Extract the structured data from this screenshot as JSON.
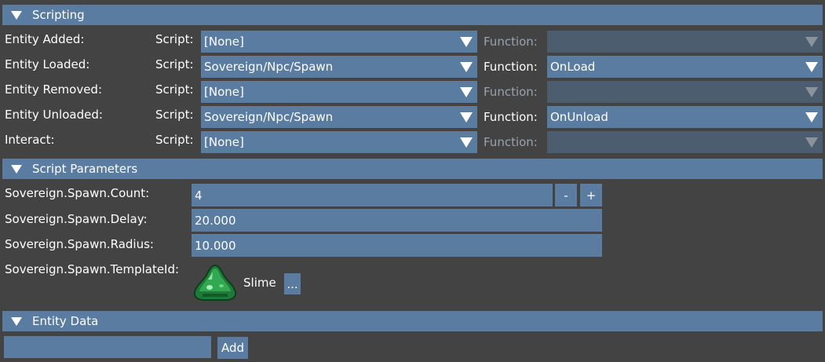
{
  "scripting": {
    "title": "Scripting",
    "script_label": "Script:",
    "function_label": "Function:",
    "rows": [
      {
        "label": "Entity Added:",
        "script": "[None]",
        "function": "",
        "function_enabled": false
      },
      {
        "label": "Entity Loaded:",
        "script": "Sovereign/Npc/Spawn",
        "function": "OnLoad",
        "function_enabled": true
      },
      {
        "label": "Entity Removed:",
        "script": "[None]",
        "function": "",
        "function_enabled": false
      },
      {
        "label": "Entity Unloaded:",
        "script": "Sovereign/Npc/Spawn",
        "function": "OnUnload",
        "function_enabled": true
      },
      {
        "label": "Interact:",
        "script": "[None]",
        "function": "",
        "function_enabled": false
      }
    ]
  },
  "script_parameters": {
    "title": "Script Parameters",
    "count": {
      "label": "Sovereign.Spawn.Count:",
      "value": "4",
      "minus": "-",
      "plus": "+"
    },
    "delay": {
      "label": "Sovereign.Spawn.Delay:",
      "value": "20.000"
    },
    "radius": {
      "label": "Sovereign.Spawn.Radius:",
      "value": "10.000"
    },
    "template": {
      "label": "Sovereign.Spawn.TemplateId:",
      "name": "Slime",
      "browse": "...",
      "icon": "slime-icon"
    }
  },
  "entity_data": {
    "title": "Entity Data",
    "input_value": "",
    "add_label": "Add"
  },
  "colors": {
    "background": "#434343",
    "accent": "#5a7ca0",
    "disabled_field": "#4d5d70",
    "disabled_text": "#9aa2ad"
  }
}
